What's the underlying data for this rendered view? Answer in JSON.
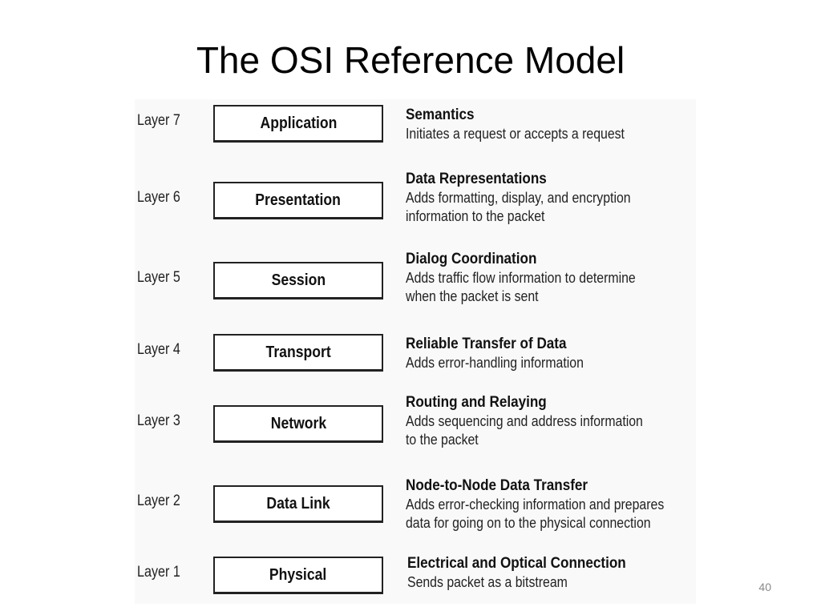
{
  "slide": {
    "title": "The OSI Reference Model",
    "page_number": "40"
  },
  "layers": [
    {
      "label": "Layer 7",
      "name": "Application",
      "function": "Semantics",
      "description": "Initiates a request or accepts a request"
    },
    {
      "label": "Layer 6",
      "name": "Presentation",
      "function": "Data Representations",
      "description": "Adds formatting, display, and encryption\ninformation to the packet"
    },
    {
      "label": "Layer 5",
      "name": "Session",
      "function": "Dialog Coordination",
      "description": "Adds traffic flow information to determine\nwhen the packet is sent"
    },
    {
      "label": "Layer 4",
      "name": "Transport",
      "function": "Reliable Transfer of Data",
      "description": "Adds error-handling information"
    },
    {
      "label": "Layer 3",
      "name": "Network",
      "function": "Routing and Relaying",
      "description": "Adds sequencing and address information\nto the packet"
    },
    {
      "label": "Layer 2",
      "name": "Data Link",
      "function": "Node-to-Node Data Transfer",
      "description": "Adds error-checking information and prepares\ndata for going on to the physical connection"
    },
    {
      "label": "Layer 1",
      "name": "Physical",
      "function": "Electrical and Optical Connection",
      "description": "Sends packet as a bitstream"
    }
  ]
}
